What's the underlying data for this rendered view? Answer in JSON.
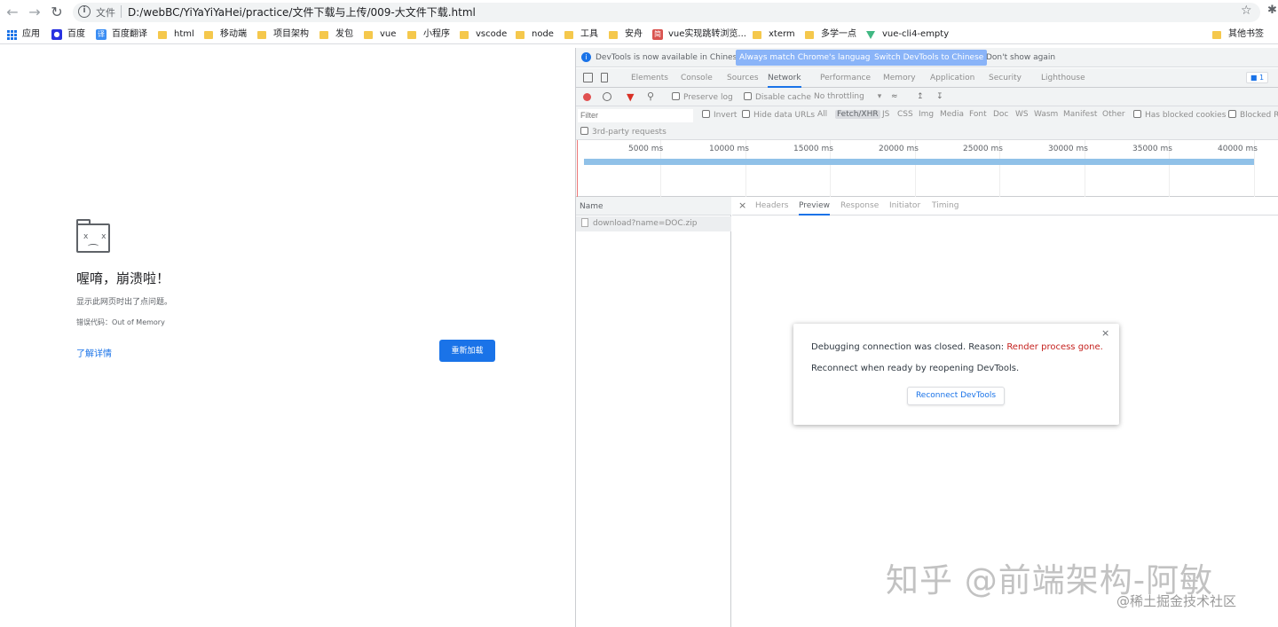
{
  "browser": {
    "back_icon": "arrow-left-icon",
    "forward_icon": "arrow-right-icon",
    "reload_icon": "reload-icon",
    "info_symbol": "i",
    "file_label": "文件",
    "url": "D:/webBC/YiYaYiYaHei/practice/文件下载与上传/009-大文件下载.html",
    "star_icon": "star-icon",
    "extension_icon": "extension-icon"
  },
  "bookmarks": {
    "items": [
      {
        "label": "应用",
        "icon": "apps-grid-icon"
      },
      {
        "label": "百度",
        "icon": "baidu-icon"
      },
      {
        "label": "百度翻译",
        "icon": "baidu-translate-icon"
      },
      {
        "label": "html",
        "icon": "folder-icon"
      },
      {
        "label": "移动端",
        "icon": "folder-icon"
      },
      {
        "label": "项目架构",
        "icon": "folder-icon"
      },
      {
        "label": "发包",
        "icon": "folder-icon"
      },
      {
        "label": "vue",
        "icon": "folder-icon"
      },
      {
        "label": "小程序",
        "icon": "folder-icon"
      },
      {
        "label": "vscode",
        "icon": "folder-icon"
      },
      {
        "label": "node",
        "icon": "folder-icon"
      },
      {
        "label": "工具",
        "icon": "folder-icon"
      },
      {
        "label": "安舟",
        "icon": "folder-icon"
      },
      {
        "label": "vue实现跳转浏览...",
        "icon": "page-icon"
      },
      {
        "label": "xterm",
        "icon": "folder-icon"
      },
      {
        "label": "多学一点",
        "icon": "folder-icon"
      },
      {
        "label": "vue-cli4-empty",
        "icon": "vue-icon"
      }
    ],
    "other": "其他书签"
  },
  "crash": {
    "icon": "sad-tab-icon",
    "face": "x x",
    "title": "喔唷，崩溃啦！",
    "description": "显示此网页时出了点问题。",
    "error_code": "错误代码：Out of Memory",
    "learn_more": "了解详情",
    "reload": "重新加载"
  },
  "devtools": {
    "infobar": {
      "message": "DevTools is now available in Chinese!",
      "match_button": "Always match Chrome's language",
      "switch_button": "Switch DevTools to Chinese",
      "dismiss": "Don't show again"
    },
    "tabs": [
      "Elements",
      "Console",
      "Sources",
      "Network",
      "Performance",
      "Memory",
      "Application",
      "Security",
      "Lighthouse"
    ],
    "active_tab": "Network",
    "issues_count": "1",
    "toolbar": {
      "preserve_log": "Preserve log",
      "disable_cache": "Disable cache",
      "throttling": "No throttling",
      "throttling_arrow": "▾"
    },
    "filter": {
      "placeholder": "Filter",
      "invert": "Invert",
      "hide_data_urls": "Hide data URLs",
      "types": [
        "All",
        "Fetch/XHR",
        "JS",
        "CSS",
        "Img",
        "Media",
        "Font",
        "Doc",
        "WS",
        "Wasm",
        "Manifest",
        "Other"
      ],
      "active_type": "Fetch/XHR",
      "blocked_cookies": "Has blocked cookies",
      "blocked_requests": "Blocked Requests",
      "third_party": "3rd-party requests"
    },
    "overview": {
      "ticks": [
        "5000 ms",
        "10000 ms",
        "15000 ms",
        "20000 ms",
        "25000 ms",
        "30000 ms",
        "35000 ms",
        "40000 ms"
      ]
    },
    "requests": {
      "header": "Name",
      "rows": [
        "download?name=DOC.zip"
      ]
    },
    "detail_tabs": [
      "Headers",
      "Preview",
      "Response",
      "Initiator",
      "Timing"
    ],
    "active_detail_tab": "Preview",
    "dialog": {
      "line1_prefix": "Debugging connection was closed. Reason: ",
      "reason": "Render process gone.",
      "line2": "Reconnect when ready by reopening DevTools.",
      "button": "Reconnect DevTools",
      "close": "×"
    }
  },
  "watermark": {
    "main": "知乎 @前端架构-阿敏",
    "sub": "@稀土掘金技术社区"
  },
  "colors": {
    "accent": "#1a73e8",
    "error": "#c5221f",
    "timeline_bar": "#90c1e8"
  }
}
